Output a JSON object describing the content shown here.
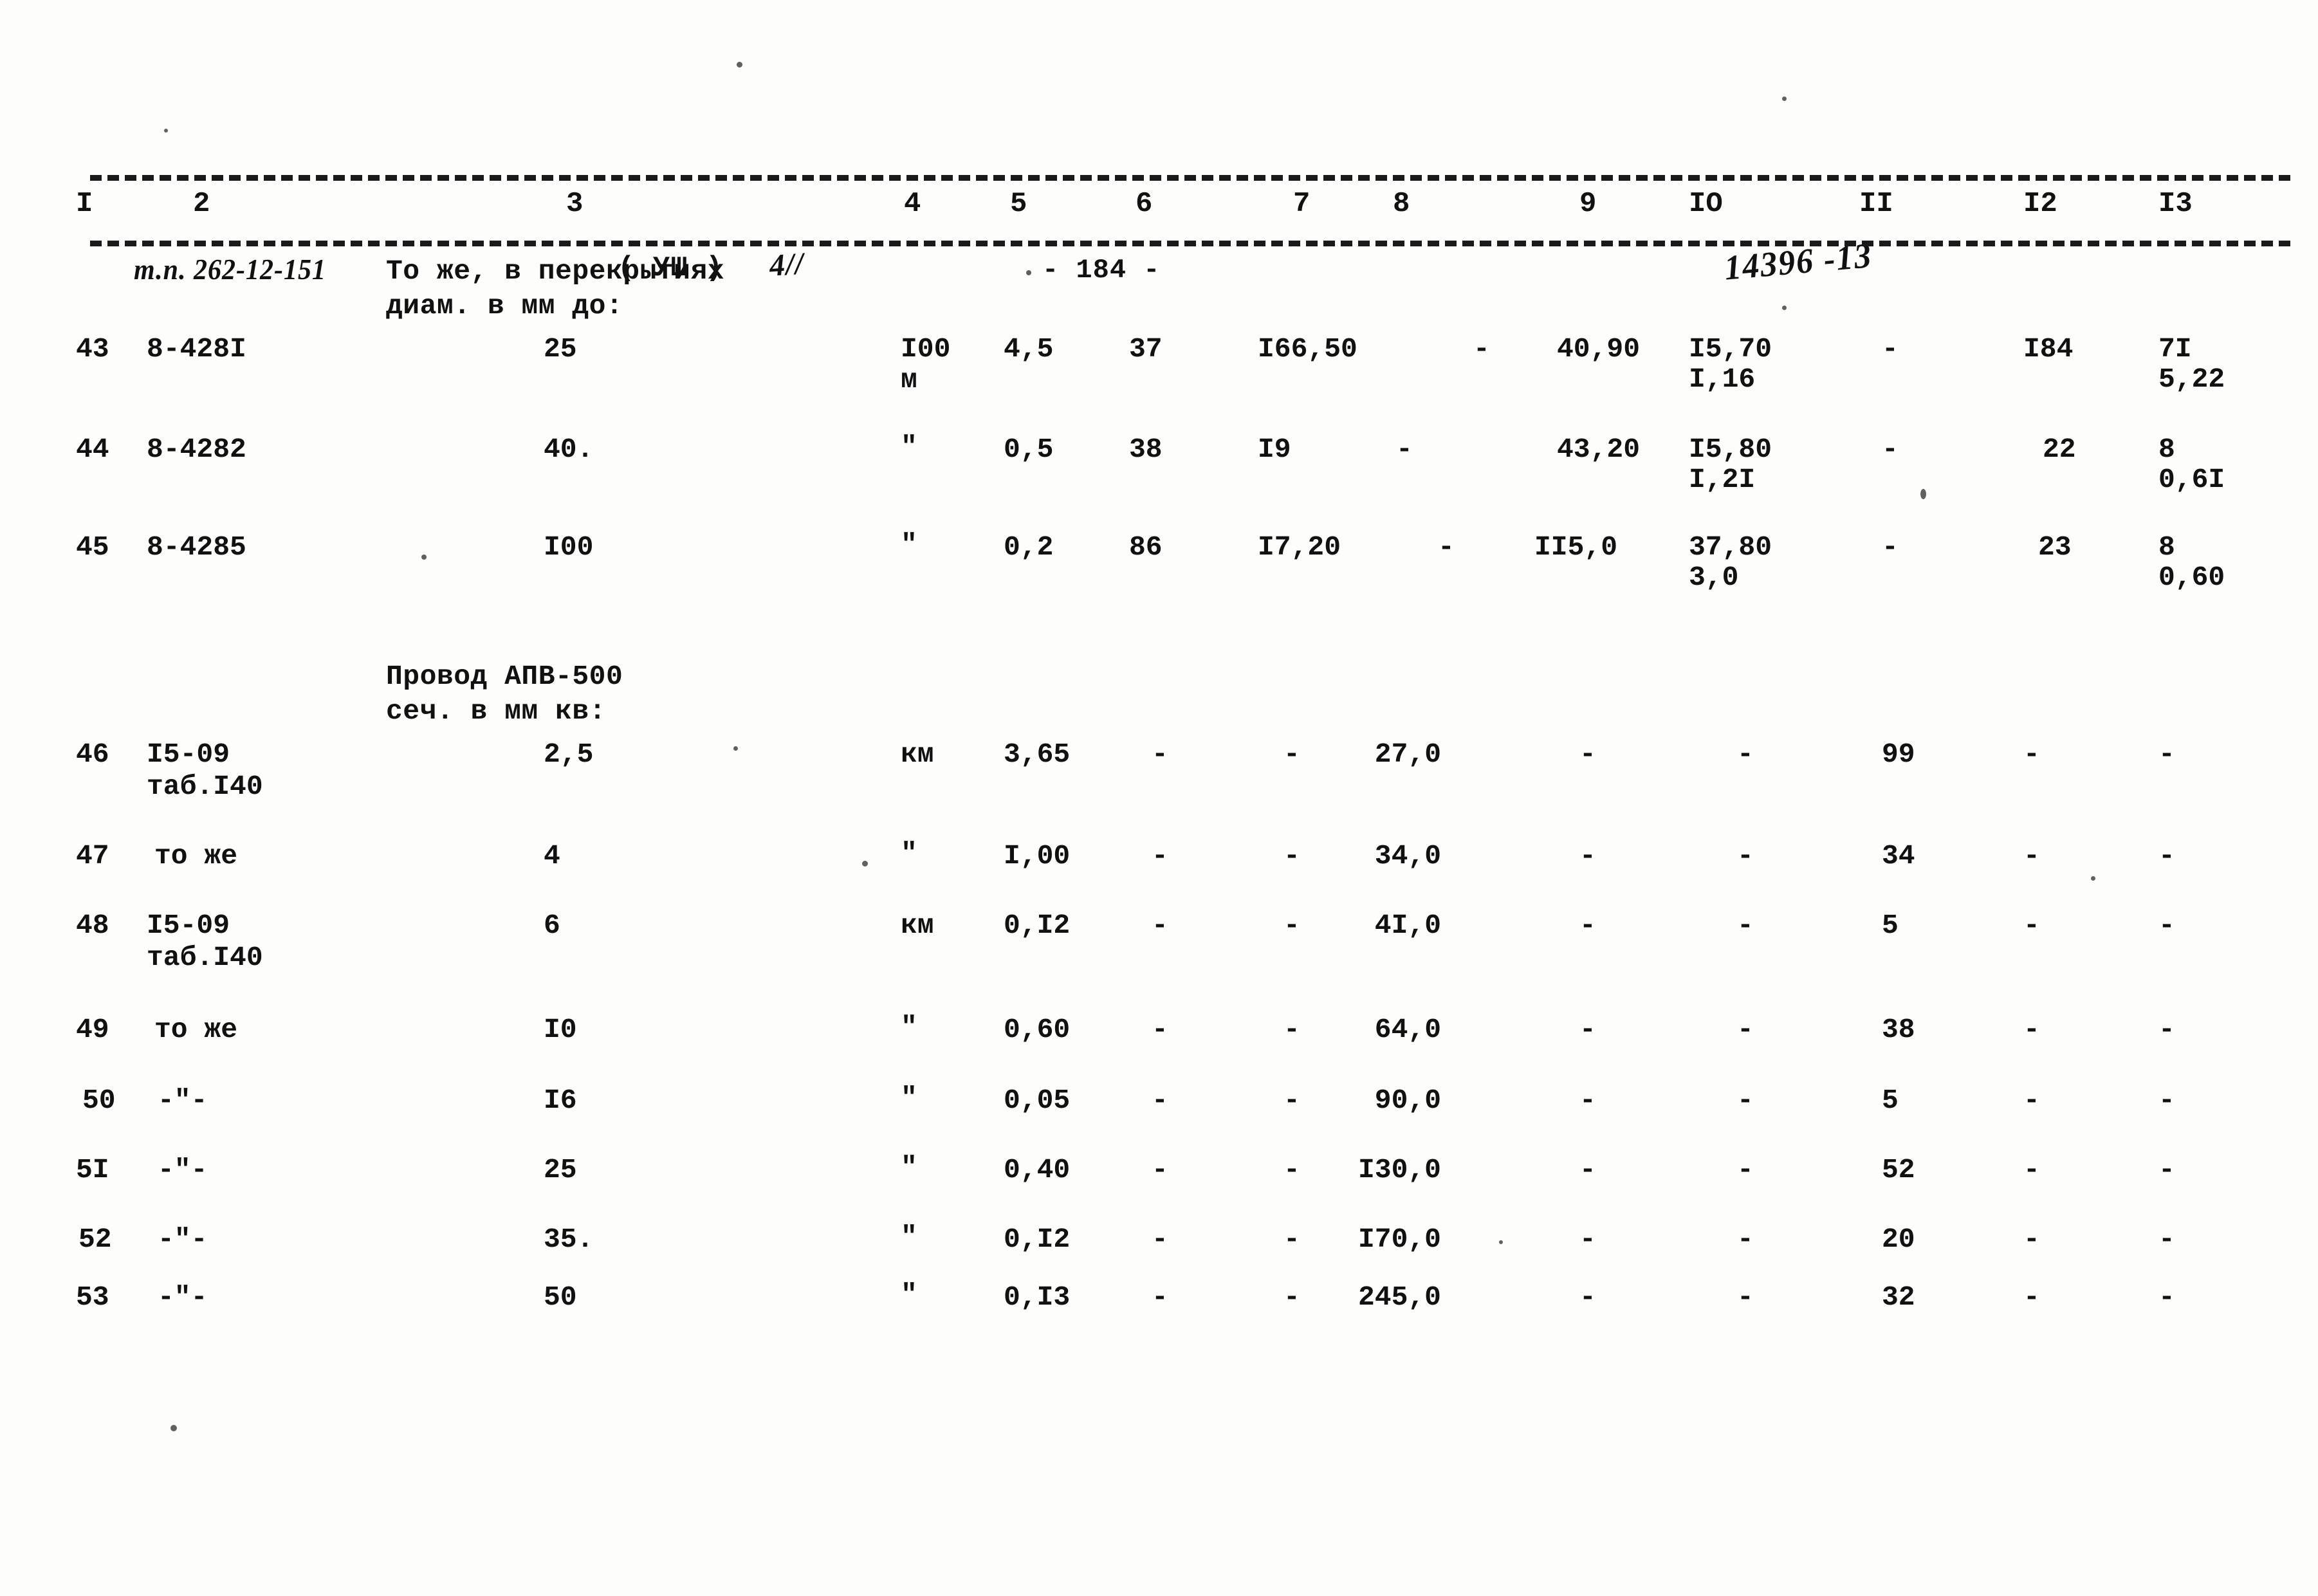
{
  "header": {
    "doc_code": "т.п. 262-12-151",
    "section_mark": "( УШ )",
    "section_hand": "4//",
    "page_number": "- 184 -",
    "archive_code": "14396 -13"
  },
  "columns": [
    "I",
    "2",
    "3",
    "4",
    "5",
    "6",
    "7",
    "8",
    "9",
    "IO",
    "II",
    "I2",
    "I3"
  ],
  "groups": [
    {
      "line1": "То же, в перекрытиях",
      "line2": "диам. в мм до:"
    },
    {
      "line1": "Провод АПВ-500",
      "line2": "сеч. в мм кв:"
    }
  ],
  "rows": [
    {
      "no": "43",
      "code": "8-428I",
      "code2": "",
      "size": "25",
      "unit": "I00",
      "unit2": "м",
      "c5": "4,5",
      "c6": "37",
      "c7": "I66,50",
      "c8": "-",
      "c9": "40,90",
      "c10": "I5,70",
      "c10b": "I,16",
      "c11": "-",
      "c12": "I84",
      "c13": "7I",
      "c13b": "5,22"
    },
    {
      "no": "44",
      "code": "8-4282",
      "code2": "",
      "size": "40.",
      "unit": "\"",
      "unit2": "",
      "c5": "0,5",
      "c6": "38",
      "c7": "I9",
      "c8": "-",
      "c9": "43,20",
      "c10": "I5,80",
      "c10b": "I,2I",
      "c11": "-",
      "c12": "22",
      "c13": "8",
      "c13b": "0,6I"
    },
    {
      "no": "45",
      "code": "8-4285",
      "code2": "",
      "size": "I00",
      "unit": "\"",
      "unit2": "",
      "c5": "0,2",
      "c6": "86",
      "c7": "I7,20",
      "c8": "-",
      "c9": "II5,0",
      "c10": "37,80",
      "c10b": "3,0",
      "c11": "-",
      "c12": "23",
      "c13": "8",
      "c13b": "0,60"
    },
    {
      "no": "46",
      "code": "I5-09",
      "code2": "таб.I40",
      "size": "2,5",
      "unit": "км",
      "unit2": "",
      "c5": "3,65",
      "c6": "-",
      "c7": "-",
      "c8": "27,0",
      "c9": "-",
      "c10": "-",
      "c10b": "",
      "c11": "99",
      "c12": "-",
      "c13": "-",
      "c13b": ""
    },
    {
      "no": "47",
      "code": "то же",
      "code2": "",
      "size": "4",
      "unit": "\"",
      "unit2": "",
      "c5": "I,00",
      "c6": "-",
      "c7": "-",
      "c8": "34,0",
      "c9": "-",
      "c10": "-",
      "c10b": "",
      "c11": "34",
      "c12": "-",
      "c13": "-",
      "c13b": ""
    },
    {
      "no": "48",
      "code": "I5-09",
      "code2": "таб.I40",
      "size": "6",
      "unit": "км",
      "unit2": "",
      "c5": "0,I2",
      "c6": "-",
      "c7": "-",
      "c8": "4I,0",
      "c9": "-",
      "c10": "-",
      "c10b": "",
      "c11": "5",
      "c12": "-",
      "c13": "-",
      "c13b": ""
    },
    {
      "no": "49",
      "code": "то же",
      "code2": "",
      "size": "I0",
      "unit": "\"",
      "unit2": "",
      "c5": "0,60",
      "c6": "-",
      "c7": "-",
      "c8": "64,0",
      "c9": "-",
      "c10": "-",
      "c10b": "",
      "c11": "38",
      "c12": "-",
      "c13": "-",
      "c13b": ""
    },
    {
      "no": "50",
      "code": "-\"-",
      "code2": "",
      "size": "I6",
      "unit": "\"",
      "unit2": "",
      "c5": "0,05",
      "c6": "-",
      "c7": "-",
      "c8": "90,0",
      "c9": "-",
      "c10": "-",
      "c10b": "",
      "c11": "5",
      "c12": "-",
      "c13": "-",
      "c13b": ""
    },
    {
      "no": "5I",
      "code": "-\"-",
      "code2": "",
      "size": "25",
      "unit": "\"",
      "unit2": "",
      "c5": "0,40",
      "c6": "-",
      "c7": "-",
      "c8": "I30,0",
      "c9": "-",
      "c10": "-",
      "c10b": "",
      "c11": "52",
      "c12": "-",
      "c13": "-",
      "c13b": ""
    },
    {
      "no": "52",
      "code": "-\"-",
      "code2": "",
      "size": "35.",
      "unit": "\"",
      "unit2": "",
      "c5": "0,I2",
      "c6": "-",
      "c7": "-",
      "c8": "I70,0",
      "c9": "-",
      "c10": "-",
      "c10b": "",
      "c11": "20",
      "c12": "-",
      "c13": "-",
      "c13b": ""
    },
    {
      "no": "53",
      "code": "-\"-",
      "code2": "",
      "size": "50",
      "unit": "\"",
      "unit2": "",
      "c5": "0,I3",
      "c6": "-",
      "c7": "-",
      "c8": "245,0",
      "c9": "-",
      "c10": "-",
      "c10b": "",
      "c11": "32",
      "c12": "-",
      "c13": "-",
      "c13b": ""
    }
  ]
}
